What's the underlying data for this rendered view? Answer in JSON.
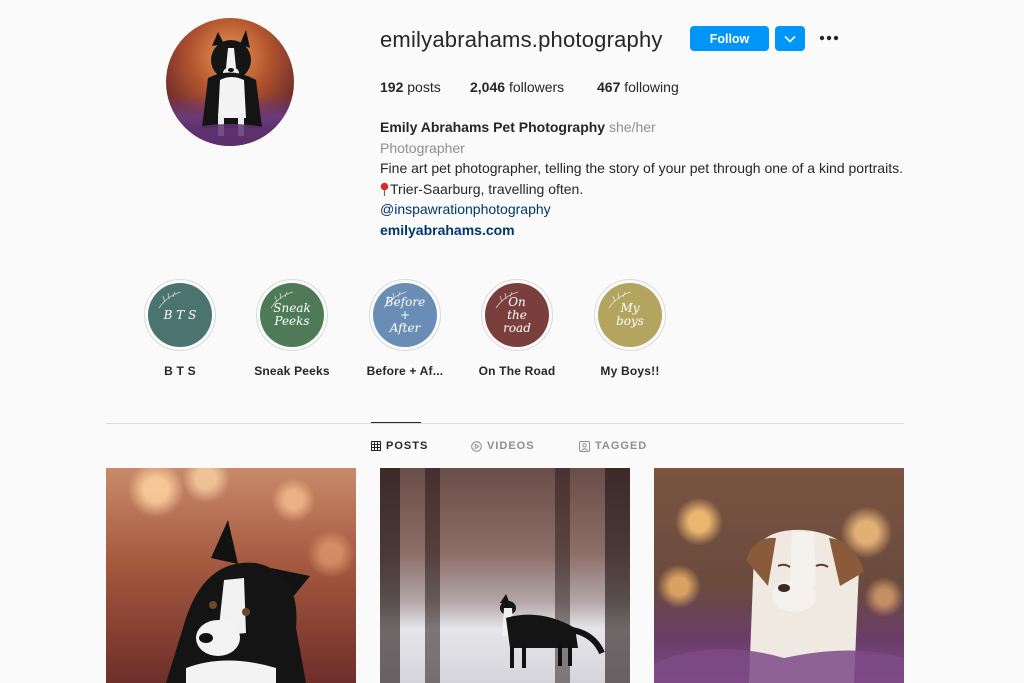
{
  "profile": {
    "username": "emilyabrahams.photography",
    "follow_label": "Follow",
    "stats": {
      "posts_count": "192",
      "posts_label": "posts",
      "followers_count": "2,046",
      "followers_label": "followers",
      "following_count": "467",
      "following_label": "following"
    },
    "bio": {
      "name": "Emily Abrahams Pet Photography",
      "pronouns": "she/her",
      "category": "Photographer",
      "description": "Fine art pet photographer, telling the story of your pet through one of a kind portraits.",
      "location": "Trier-Saarburg, travelling often.",
      "mention": "@inspawrationphotography",
      "link": "emilyabrahams.com"
    }
  },
  "highlights": [
    {
      "title": "B T S",
      "cover_text": "B T S",
      "color": "#4b7470"
    },
    {
      "title": "Sneak Peeks",
      "cover_text": "Sneak Peeks",
      "color": "#4f7a57"
    },
    {
      "title": "Before + Af...",
      "cover_text": "Before + After",
      "color": "#6a8db5"
    },
    {
      "title": "On The Road",
      "cover_text": "On the road",
      "color": "#7a3f3c"
    },
    {
      "title": "My Boys!!",
      "cover_text": "My boys",
      "color": "#b3a55f"
    }
  ],
  "tabs": [
    {
      "label": "POSTS",
      "icon": "grid-icon",
      "active": true
    },
    {
      "label": "VIDEOS",
      "icon": "play-icon",
      "active": false
    },
    {
      "label": "TAGGED",
      "icon": "tag-icon",
      "active": false
    }
  ],
  "colors": {
    "accent": "#0095f6",
    "link": "#00376b",
    "muted": "#8e8e8e",
    "background": "#fafafa"
  }
}
